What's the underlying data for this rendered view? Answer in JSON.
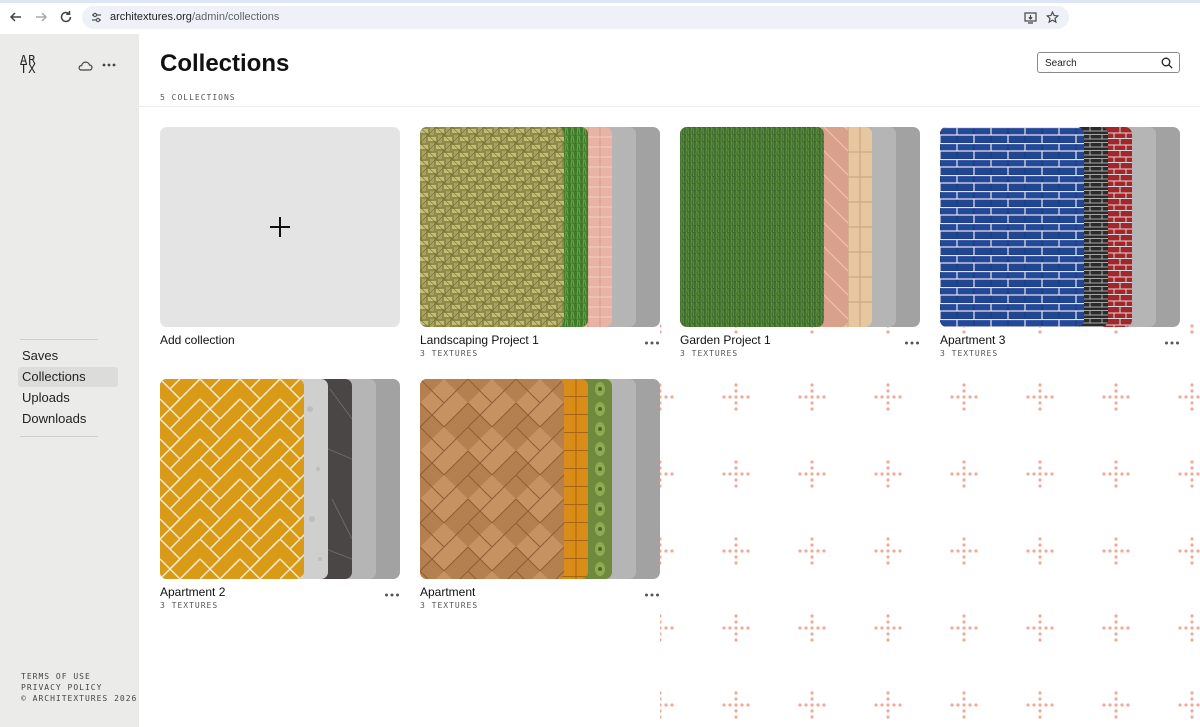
{
  "browser": {
    "url_host": "architextures.org",
    "url_path": "/admin/collections"
  },
  "sidebar": {
    "logo_lines": [
      "AR",
      "TX"
    ],
    "nav": [
      {
        "label": "Saves",
        "active": false
      },
      {
        "label": "Collections",
        "active": true
      },
      {
        "label": "Uploads",
        "active": false
      },
      {
        "label": "Downloads",
        "active": false
      }
    ],
    "footer": [
      "TERMS OF USE",
      "PRIVACY POLICY",
      "© ARCHITEXTURES 2026"
    ]
  },
  "page": {
    "title": "Collections",
    "count": "5 COLLECTIONS",
    "search_placeholder": "Search",
    "add_label": "Add collection"
  },
  "collections": [
    {
      "name": "Landscaping Project 1",
      "textures": "3 TEXTURES"
    },
    {
      "name": "Garden Project 1",
      "textures": "3 TEXTURES"
    },
    {
      "name": "Apartment 3",
      "textures": "3 TEXTURES"
    },
    {
      "name": "Apartment 2",
      "textures": "3 TEXTURES"
    },
    {
      "name": "Apartment",
      "textures": "3 TEXTURES"
    }
  ],
  "colors": {
    "sidebar_bg": "#ebebe9",
    "dot_pattern": "#f1a999",
    "placeholder_sheet_1": "#b5b5b5",
    "placeholder_sheet_2": "#a2a2a2"
  }
}
